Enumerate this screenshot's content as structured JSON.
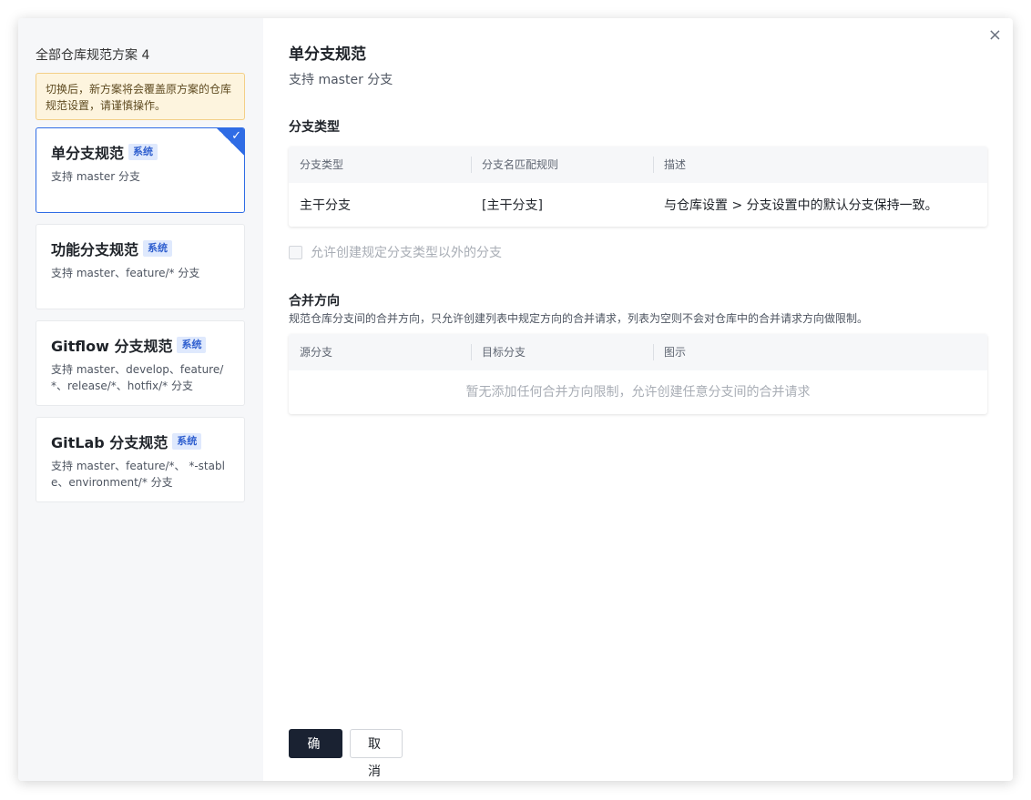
{
  "sidebar": {
    "title": "全部仓库规范方案 4",
    "notice": "切换后，新方案将会覆盖原方案的仓库规范设置，请谨慎操作。",
    "schemes": [
      {
        "title": "单分支规范",
        "tag": "系统",
        "desc": "支持 master 分支"
      },
      {
        "title": "功能分支规范",
        "tag": "系统",
        "desc": "支持 master、feature/* 分支"
      },
      {
        "title": "Gitflow 分支规范",
        "tag": "系统",
        "desc": "支持 master、develop、feature/*、release/*、hotfix/* 分支"
      },
      {
        "title": "GitLab 分支规范",
        "tag": "系统",
        "desc": "支持 master、feature/*、 *-stable、environment/* 分支"
      }
    ],
    "selected_check": "✓"
  },
  "main": {
    "close": "×",
    "title": "单分支规范",
    "subtitle": "支持 master 分支",
    "branch_section": {
      "title": "分支类型",
      "headers": [
        "分支类型",
        "分支名匹配规则",
        "描述"
      ],
      "rows": [
        {
          "type": "主干分支",
          "rule": "[主干分支]",
          "desc": "与仓库设置 > 分支设置中的默认分支保持一致。"
        }
      ]
    },
    "allow_other_label": "允许创建规定分支类型以外的分支",
    "merge_section": {
      "title": "合并方向",
      "desc": "规范仓库分支间的合并方向，只允许创建列表中规定方向的合并请求，列表为空则不会对仓库中的合并请求方向做限制。",
      "headers": [
        "源分支",
        "目标分支",
        "图示"
      ],
      "empty": "暂无添加任何合并方向限制，允许创建任意分支间的合并请求"
    }
  },
  "footer": {
    "confirm": "确认",
    "cancel": "取消"
  },
  "colors": {
    "accent": "#2f6ce5",
    "primary_button": "#1a2232",
    "notice_bg": "#fdf4de"
  }
}
